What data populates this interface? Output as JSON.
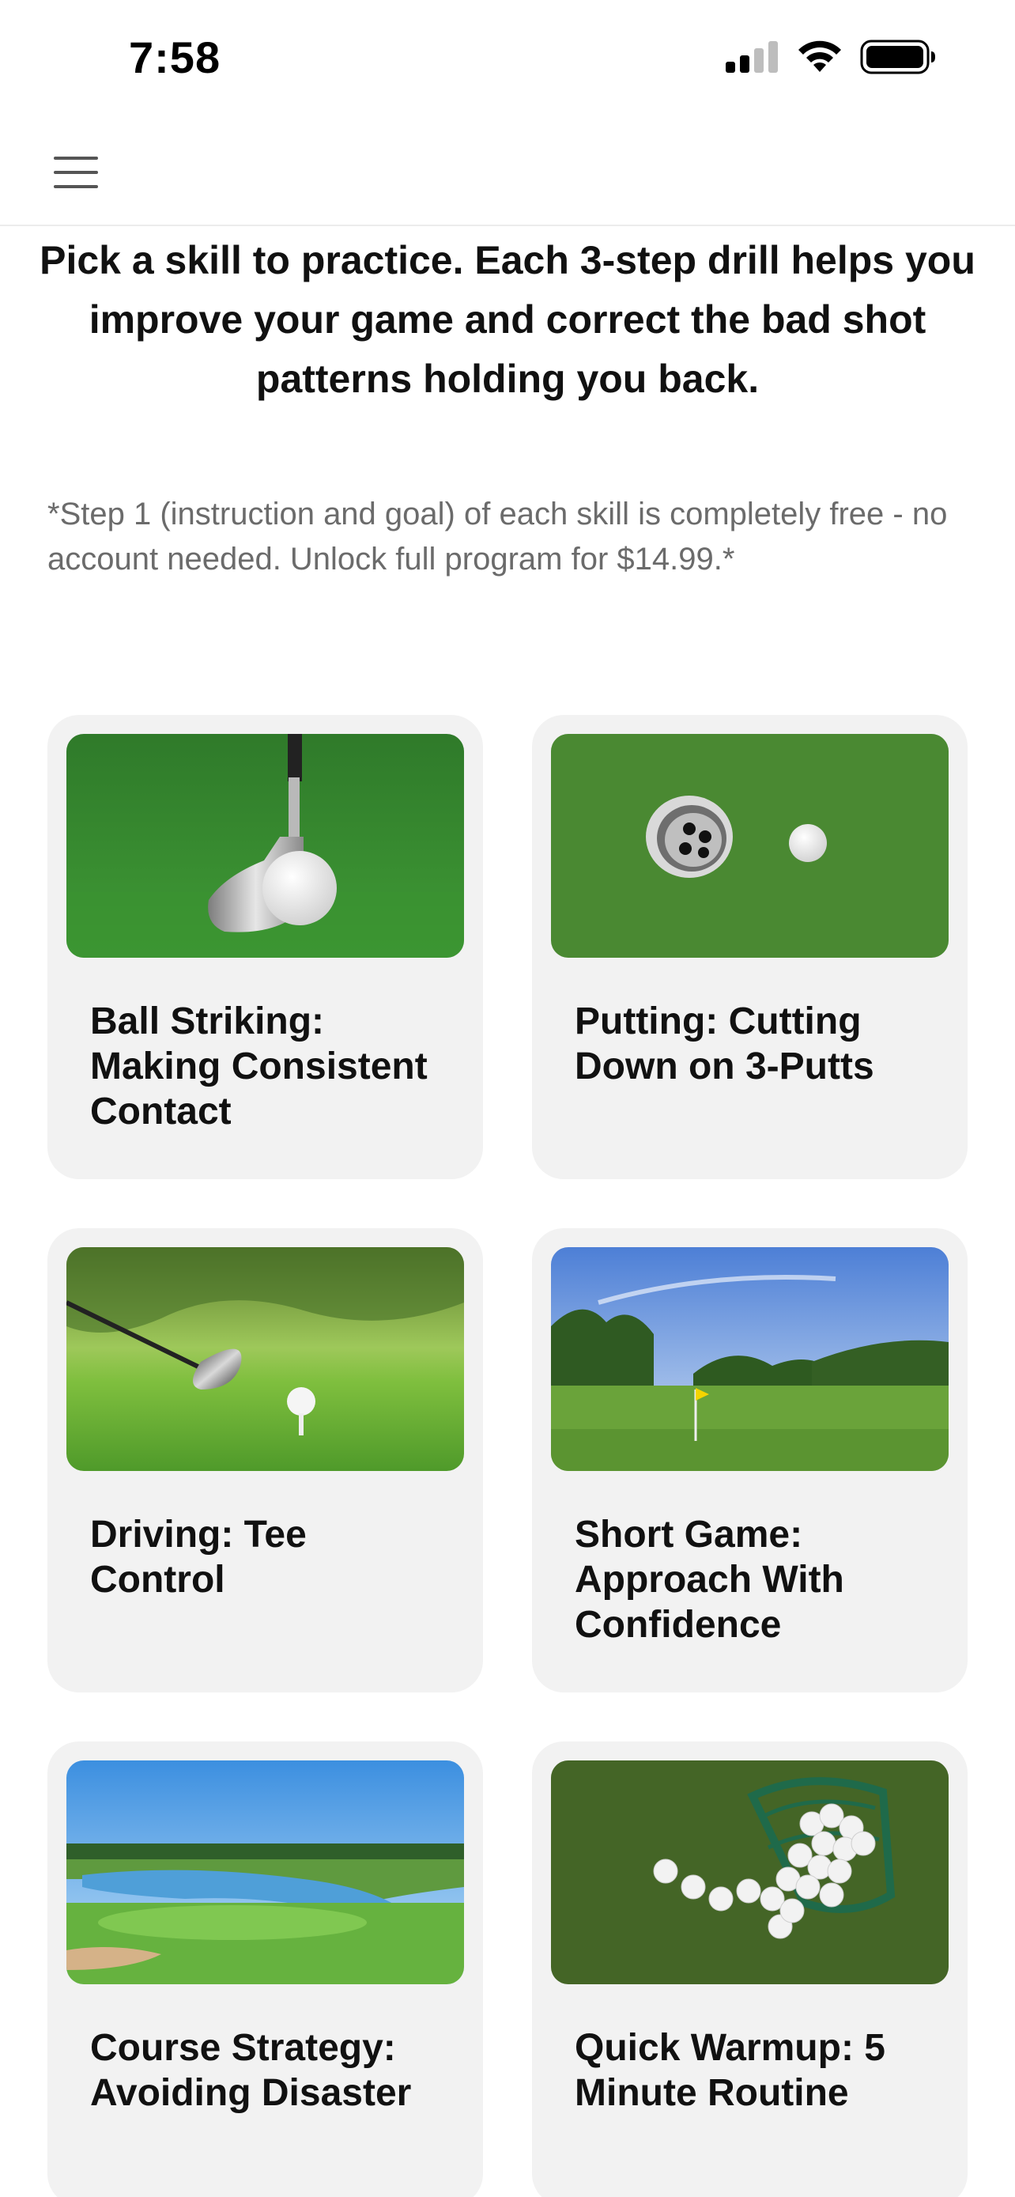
{
  "status_bar": {
    "time": "7:58",
    "icons": [
      "signal-icon",
      "wifi-icon",
      "battery-icon"
    ]
  },
  "nav": {
    "menu_icon": "hamburger-menu-icon"
  },
  "intro": {
    "headline": "Pick a skill to practice. Each 3-step drill helps you improve your game and correct the bad shot patterns holding you back.",
    "note": "*Step 1 (instruction and goal) of each skill is completely free - no account needed. Unlock full program for $14.99.*"
  },
  "skills": [
    {
      "title": "Ball Striking: Making Consistent Contact",
      "image": "iron-club-and-ball-on-grass"
    },
    {
      "title": "Putting: Cutting Down on 3-Putts",
      "image": "golf-hole-and-ball"
    },
    {
      "title": "Driving: Tee Control",
      "image": "driver-and-ball-on-tee"
    },
    {
      "title": "Short Game: Approach With Confidence",
      "image": "green-with-flag-and-trees"
    },
    {
      "title": "Course Strategy: Avoiding Disaster",
      "image": "course-with-lake"
    },
    {
      "title": "Quick Warmup: 5 Minute Routine",
      "image": "bucket-of-range-balls"
    }
  ],
  "colors": {
    "card_background": "#f2f2f2",
    "note_text": "#6b6b6b",
    "grass": "#3f8a2e"
  }
}
